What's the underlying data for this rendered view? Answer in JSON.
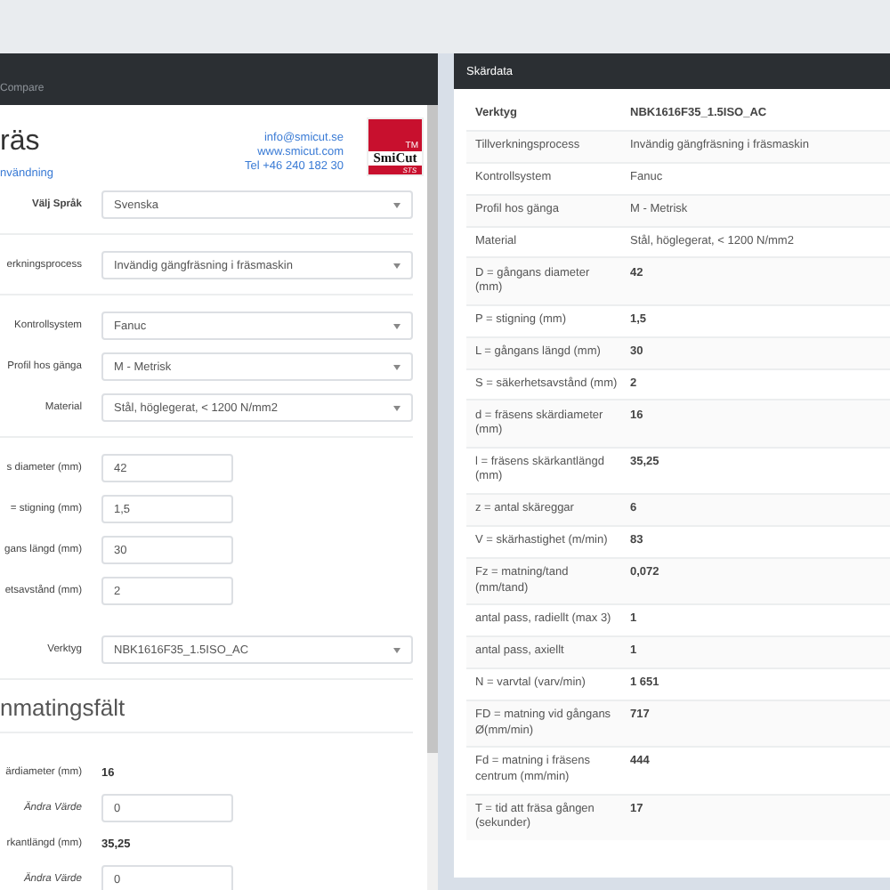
{
  "left_panel": {
    "header_text": "Compare",
    "title": "räs",
    "link": "nvändning",
    "contact": [
      "info@smicut.se",
      "www.smicut.com",
      "Tel +46 240 182 30"
    ],
    "logo": {
      "trademark": "TM",
      "name": "SmiCut",
      "tagline": "STS"
    },
    "form_groups": [
      [
        {
          "kind": "select",
          "label": "Välj Språk",
          "value": "Svenska",
          "bold": true
        }
      ],
      [
        {
          "kind": "select",
          "label": "erkningsprocess",
          "value": "Invändig gängfräsning i fräsmaskin",
          "bold": false
        }
      ],
      [
        {
          "kind": "select",
          "label": "Kontrollsystem",
          "value": "Fanuc",
          "bold": false
        },
        {
          "kind": "select",
          "label": "Profil hos gänga",
          "value": "M - Metrisk",
          "bold": false
        },
        {
          "kind": "select",
          "label": "Material",
          "value": "Stål, höglegerat, < 1200 N/mm2",
          "bold": false
        }
      ],
      [
        {
          "kind": "input",
          "label": "s diameter (mm)",
          "value": "42",
          "bold": false
        },
        {
          "kind": "input",
          "label": "= stigning (mm)",
          "value": "1,5",
          "bold": false
        },
        {
          "kind": "input",
          "label": "gans längd (mm)",
          "value": "30",
          "bold": false
        },
        {
          "kind": "input",
          "label": "etsavstånd (mm)",
          "value": "2",
          "bold": false
        },
        {
          "kind": "select",
          "label": "Verktyg",
          "value": "NBK1616F35_1.5ISO_AC",
          "bold": false
        }
      ]
    ],
    "section_heading": "nmatingsfält",
    "result_fields": [
      {
        "kind": "readout",
        "label": "ärdiameter (mm)",
        "value": "16"
      },
      {
        "kind": "override",
        "label": "Ändra Värde",
        "value": "0"
      },
      {
        "kind": "readout",
        "label": "rkantlängd (mm)",
        "value": "35,25"
      },
      {
        "kind": "override",
        "label": "Ändra Värde",
        "value": "0"
      }
    ]
  },
  "cut_data": {
    "title": "Skärdata",
    "rows": [
      {
        "kind": "head",
        "label": "Verktyg",
        "value": "NBK1616F35_1.5ISO_AC"
      },
      {
        "kind": "text",
        "label": "Tillverkningsprocess",
        "value": "Invändig gängfräsning i fräsmaskin"
      },
      {
        "kind": "text",
        "label": "Kontrollsystem",
        "value": "Fanuc"
      },
      {
        "kind": "text",
        "label": "Profil hos gänga",
        "value": "M - Metrisk"
      },
      {
        "kind": "text",
        "label": "Material",
        "value": "Stål, höglegerat, < 1200 N/mm2"
      },
      {
        "kind": "number",
        "label": "D = gångans diameter (mm)",
        "value": "42"
      },
      {
        "kind": "number",
        "label": "P = stigning (mm)",
        "value": "1,5"
      },
      {
        "kind": "number",
        "label": "L = gångans längd (mm)",
        "value": "30"
      },
      {
        "kind": "number",
        "label": "S = säkerhetsavstånd (mm)",
        "value": "2"
      },
      {
        "kind": "number",
        "label": "d = fräsens skärdiameter (mm)",
        "value": "16"
      },
      {
        "kind": "number",
        "label": "l = fräsens skärkantlängd (mm)",
        "value": "35,25"
      },
      {
        "kind": "number",
        "label": "z = antal skäreggar",
        "value": "6"
      },
      {
        "kind": "number",
        "label": "V = skärhastighet (m/min)",
        "value": "83"
      },
      {
        "kind": "number",
        "label": "Fz = matning/tand (mm/tand)",
        "value": "0,072"
      },
      {
        "kind": "number",
        "label": "antal pass, radiellt (max 3)",
        "value": "1"
      },
      {
        "kind": "number",
        "label": "antal pass, axiellt",
        "value": "1"
      },
      {
        "kind": "number",
        "label": "N = varvtal (varv/min)",
        "value": "1 651"
      },
      {
        "kind": "number",
        "label": "FD = matning vid gångans Ø(mm/min)",
        "value": "717"
      },
      {
        "kind": "number",
        "label": "Fd = matning i fräsens centrum (mm/min)",
        "value": "444"
      },
      {
        "kind": "number",
        "label": "T = tid att fräsa gången (sekunder)",
        "value": "17"
      }
    ]
  }
}
